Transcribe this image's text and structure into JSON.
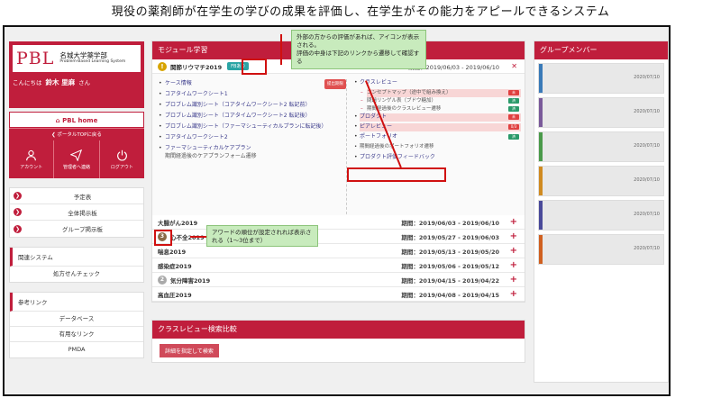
{
  "page_title": "現役の薬剤師が在学生の学びの成果を評価し、在学生がその能力をアピールできるシステム",
  "logo": {
    "mark": "PBL",
    "name": "名城大学薬学部",
    "subtitle": "Problem-Based Learning System"
  },
  "greeting": {
    "prefix": "こんにちは",
    "name": "鈴木 里麻",
    "suffix": "さん"
  },
  "home_button": "PBL home",
  "portal_button": "ポータルTOPに戻る",
  "icon_buttons": [
    {
      "label": "アカウント",
      "icon": "person-icon"
    },
    {
      "label": "管理者へ連絡",
      "icon": "send-icon"
    },
    {
      "label": "ログアウト",
      "icon": "power-icon"
    }
  ],
  "nav_items": [
    "予定表",
    "全体掲示板",
    "グループ掲示板"
  ],
  "related_system": {
    "title": "関連システム",
    "links": [
      "処方せんチェック"
    ]
  },
  "reference_links": {
    "title": "参考リンク",
    "links": [
      "データベース",
      "有用なリンク",
      "PMDA"
    ]
  },
  "module": {
    "header": "モジュール学習",
    "active": {
      "icon": "warning-icon",
      "title": "関節リウマチ2019",
      "badge": "FBあり",
      "period": "期間：2019/06/03 - 2019/06/10",
      "close": "✕"
    },
    "left_items": [
      {
        "text": "ケース情報",
        "tag": "提出期限"
      },
      {
        "text": "コアタイムワークシート1"
      },
      {
        "text": "プロブレム識別シート（コアタイムワークシート2 転記前）"
      },
      {
        "text": "プロブレム識別シート（コアタイムワークシート2 転記後）"
      },
      {
        "text": "プロブレム識別シート（ファーマシューティカルプランに転記後）"
      },
      {
        "text": "コアタイムワークシート2"
      },
      {
        "text": "ファーマシューティカルケアプラン",
        "sub": "期間経過後のケアプランフォーム遷移"
      }
    ],
    "right_items": [
      {
        "text": "クラスレビュー"
      },
      {
        "sub": "コンセプトマップ（途中で組み換え）",
        "status": "未"
      },
      {
        "sub": "問題リンゲル表（ブドウ糖加）",
        "status": "済"
      },
      {
        "sub": "期間経過後のクラスレビュー遷移",
        "status": "済"
      },
      {
        "text": "プロダクト",
        "status": "未"
      },
      {
        "text": "ピアレビュー",
        "status": "0/3"
      },
      {
        "text": "ポートフォリオ",
        "status": "済"
      },
      {
        "sub2": "期間経過後のポートフォリオ遷移"
      },
      {
        "text": "プロダクト評価フィードバック"
      }
    ],
    "rows": [
      {
        "title": "大腸がん2019",
        "period": "期間：2019/06/03 - 2019/06/10"
      },
      {
        "title": "心不全2019",
        "period": "期間：2019/05/27 - 2019/06/03",
        "rank": "3"
      },
      {
        "title": "喘息2019",
        "period": "期間：2019/05/13 - 2019/05/20"
      },
      {
        "title": "感染症2019",
        "period": "期間：2019/05/06 - 2019/05/12"
      },
      {
        "title": "気分障害2019",
        "period": "期間：2019/04/15 - 2019/04/22",
        "rank": "2"
      },
      {
        "title": "高血圧2019",
        "period": "期間：2019/04/08 - 2019/04/15"
      }
    ]
  },
  "review": {
    "header": "クラスレビュー検索比較",
    "button": "詳細を指定して検索"
  },
  "group": {
    "header": "グループメンバー",
    "members": [
      {
        "date": "2020/07/10",
        "color": "#3a7ab8"
      },
      {
        "date": "2020/07/10",
        "color": "#7a5a9a"
      },
      {
        "date": "2020/07/10",
        "color": "#4a9a4a"
      },
      {
        "date": "2020/07/10",
        "color": "#d08a20"
      },
      {
        "date": "2020/07/10",
        "color": "#4a4a9a"
      },
      {
        "date": "2020/07/10",
        "color": "#d06020"
      }
    ]
  },
  "callouts": {
    "feedback": "外部の方からの評価があれば、アイコンが表示される。\n評価の中身は下記のリンクから遷移して確認する",
    "award": "アワードの順位が設定されれば表示される（1〜3位まで）"
  }
}
